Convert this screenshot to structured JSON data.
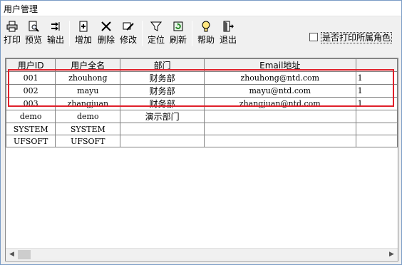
{
  "window": {
    "title": "用户管理"
  },
  "toolbar": {
    "buttons": [
      {
        "label": "打印",
        "icon": "printer-icon"
      },
      {
        "label": "预览",
        "icon": "preview-icon"
      },
      {
        "label": "输出",
        "icon": "export-icon"
      },
      {
        "label": "增加",
        "icon": "add-icon"
      },
      {
        "label": "删除",
        "icon": "delete-icon"
      },
      {
        "label": "修改",
        "icon": "edit-icon"
      },
      {
        "label": "定位",
        "icon": "filter-icon"
      },
      {
        "label": "刷新",
        "icon": "refresh-icon"
      },
      {
        "label": "帮助",
        "icon": "help-icon"
      },
      {
        "label": "退出",
        "icon": "exit-icon"
      }
    ]
  },
  "options": {
    "show_roles_label": "是否打印所属角色",
    "show_roles_checked": false
  },
  "table": {
    "columns": [
      "用户ID",
      "用户全名",
      "部门",
      "Email地址"
    ],
    "rows": [
      {
        "id": "001",
        "name": "zhouhong",
        "dept": "财务部",
        "email": "zhouhong@ntd.com",
        "extra": "1"
      },
      {
        "id": "002",
        "name": "mayu",
        "dept": "财务部",
        "email": "mayu@ntd.com",
        "extra": "1"
      },
      {
        "id": "003",
        "name": "zhangjuan",
        "dept": "财务部",
        "email": "zhangjuan@ntd.com",
        "extra": "1"
      },
      {
        "id": "demo",
        "name": "demo",
        "dept": "演示部门",
        "email": "",
        "extra": ""
      },
      {
        "id": "SYSTEM",
        "name": "SYSTEM",
        "dept": "",
        "email": "",
        "extra": ""
      },
      {
        "id": "UFSOFT",
        "name": "UFSOFT",
        "dept": "",
        "email": "",
        "extra": ""
      }
    ]
  },
  "colors": {
    "highlight": "#e0202a",
    "window_border": "#7a9cc6"
  }
}
